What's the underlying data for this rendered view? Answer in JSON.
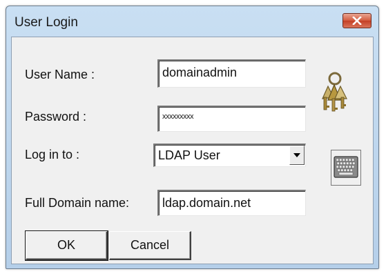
{
  "window": {
    "title": "User Login"
  },
  "form": {
    "user_name_label": "User Name :",
    "user_name_value": "domainadmin",
    "password_label": "Password :",
    "password_value": "xxxxxxxxx",
    "login_to_label": "Log in to :",
    "login_to_value": "LDAP User",
    "full_domain_label": "Full Domain name:",
    "full_domain_value": "ldap.domain.net"
  },
  "buttons": {
    "ok_label": "OK",
    "cancel_label": "Cancel"
  },
  "icons": {
    "close": "close-icon",
    "keys": "keys-icon",
    "keyboard": "keyboard-icon",
    "dropdown": "chevron-down-icon"
  }
}
